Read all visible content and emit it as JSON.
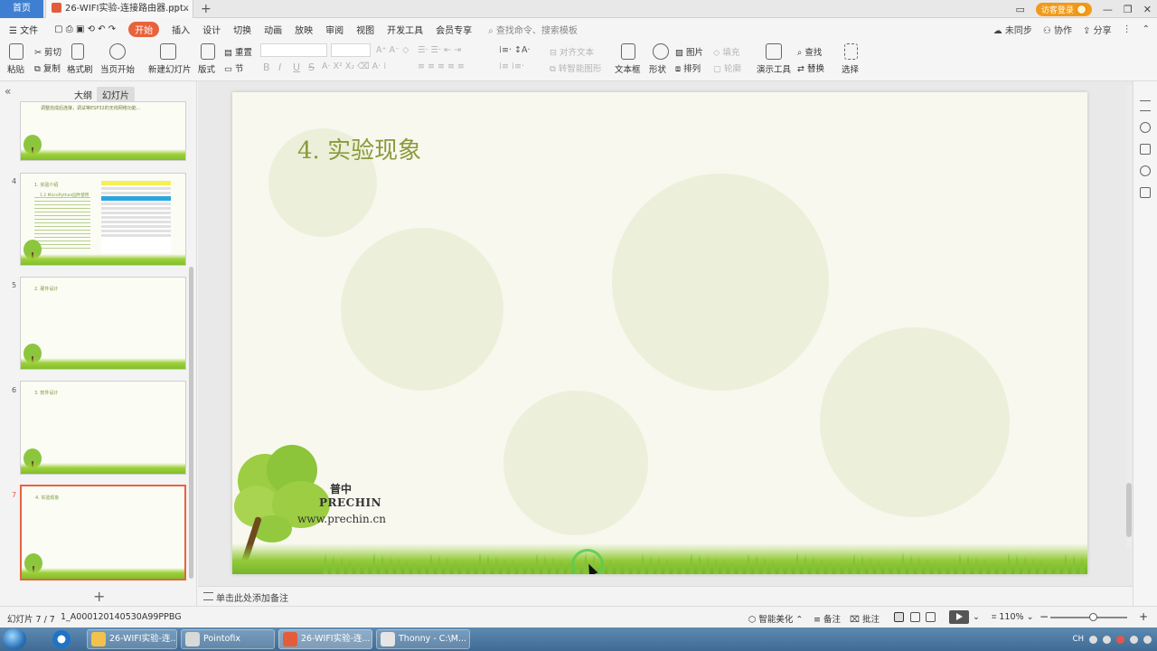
{
  "titlebar": {
    "home_tab": "首页",
    "doc_tab": "26-WIFI实验-连接路由器.pptx",
    "new_tab": "+",
    "login": "访客登录"
  },
  "menubar": {
    "file": "文件",
    "items": [
      "开始",
      "插入",
      "设计",
      "切换",
      "动画",
      "放映",
      "审阅",
      "视图",
      "开发工具",
      "会员专享"
    ],
    "active_index": 0,
    "search": "查找命令、搜索模板",
    "right": [
      "未同步",
      "协作",
      "分享"
    ]
  },
  "ribbon": {
    "paste": "粘贴",
    "cut": "剪切",
    "copy": "复制",
    "format_painter": "格式刷",
    "from_current": "当页开始",
    "new_slide": "新建幻灯片",
    "layout": "版式",
    "section": "节",
    "reset": "重置",
    "align_text": "对齐文本",
    "smart_art": "转智能图形",
    "textbox": "文本框",
    "shape": "形状",
    "arrange": "排列",
    "picture": "图片",
    "fill": "填充",
    "outline": "轮廓",
    "present_tools": "演示工具",
    "find": "查找",
    "replace": "替换",
    "select": "选择",
    "bold": "B",
    "italic": "I",
    "underline": "U",
    "strike": "S"
  },
  "leftpanel": {
    "tab_outline": "大纲",
    "tab_slides": "幻灯片",
    "thumbs": [
      {
        "num": "",
        "title": "调整完成后连接，调试等ESP32的无线网络功能..."
      },
      {
        "num": "4",
        "title": "1. 实验介绍"
      },
      {
        "num": "5",
        "title": "2. 硬件设计"
      },
      {
        "num": "6",
        "title": "3. 软件设计"
      },
      {
        "num": "7",
        "title": "4. 实验现象"
      }
    ],
    "thumb4_subtitle": "1.2 MicroPython固件使用",
    "add": "+"
  },
  "slide": {
    "title": "4. 实验现象",
    "logo_cn": "普中",
    "logo_en": "PRECHIN",
    "logo_url": "www.prechin.cn"
  },
  "notes": {
    "placeholder": "单击此处添加备注"
  },
  "statusbar": {
    "slide_index": "幻灯片 7 / 7",
    "template": "1_A000120140530A99PPBG",
    "smart_beautify": "智能美化",
    "notes": "备注",
    "comments": "批注",
    "zoom": "110%",
    "zoom_minus": "−",
    "zoom_plus": "+"
  },
  "taskbar": {
    "tasks": [
      "26-WIFI实验-连...",
      "Pointofix",
      "26-WIFI实验-连...",
      "Thonny  -  C:\\M..."
    ],
    "active_index": 2,
    "tray_lang": "CH"
  },
  "colors": {
    "accent": "#e8623c",
    "home_tab": "#3f7fd1",
    "title_green": "#8b9a3b",
    "grass": "#86c236"
  }
}
